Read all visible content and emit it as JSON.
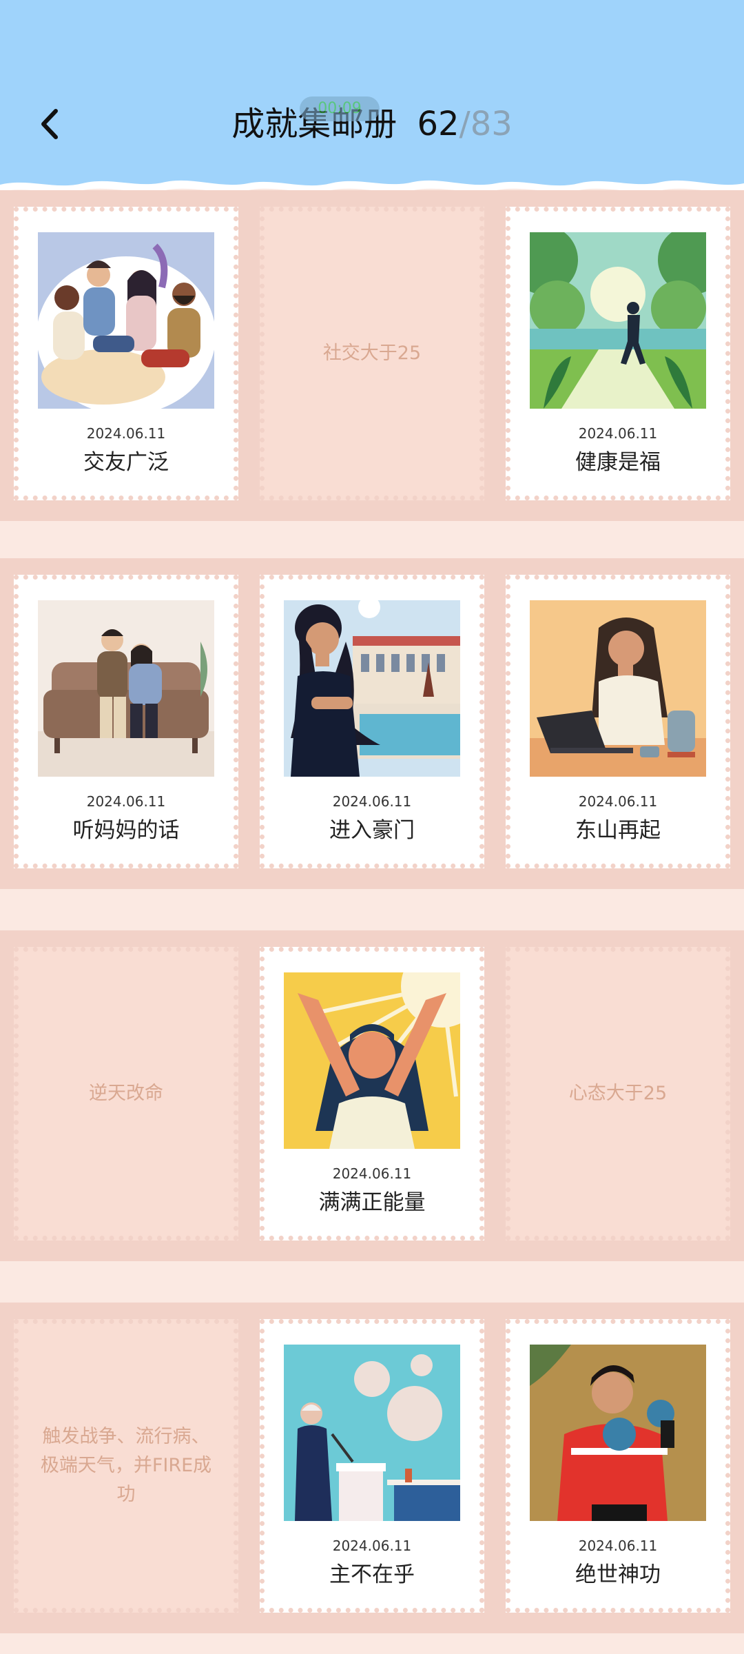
{
  "header": {
    "title": "成就集邮册",
    "count_done": "62",
    "separator": "/",
    "count_total": "83",
    "pill": "00:09",
    "side_handle": "zz",
    "back_icon": "chevron-left-icon"
  },
  "stamps": [
    {
      "state": "filled",
      "date": "2024.06.11",
      "name": "交友广泛",
      "image": "group-friends-illustration"
    },
    {
      "state": "empty",
      "hint": "社交大于25"
    },
    {
      "state": "filled",
      "date": "2024.06.11",
      "name": "健康是福",
      "image": "runner-sunrise-illustration"
    },
    {
      "state": "filled",
      "date": "2024.06.11",
      "name": "听妈妈的话",
      "image": "couple-sofa-illustration"
    },
    {
      "state": "filled",
      "date": "2024.06.11",
      "name": "进入豪门",
      "image": "woman-villa-pool-illustration"
    },
    {
      "state": "filled",
      "date": "2024.06.11",
      "name": "东山再起",
      "image": "woman-laptop-illustration"
    },
    {
      "state": "empty",
      "hint": "逆天改命"
    },
    {
      "state": "filled",
      "date": "2024.06.11",
      "name": "满满正能量",
      "image": "joyful-woman-sun-illustration"
    },
    {
      "state": "empty",
      "hint": "心态大于25"
    },
    {
      "state": "empty",
      "hint": "触发战争、流行病、极端天气，并FIRE成功"
    },
    {
      "state": "filled",
      "date": "2024.06.11",
      "name": "主不在乎",
      "image": "speaker-podium-illustration"
    },
    {
      "state": "filled",
      "date": "2024.06.11",
      "name": "绝世神功",
      "image": "boxer-illustration"
    }
  ]
}
